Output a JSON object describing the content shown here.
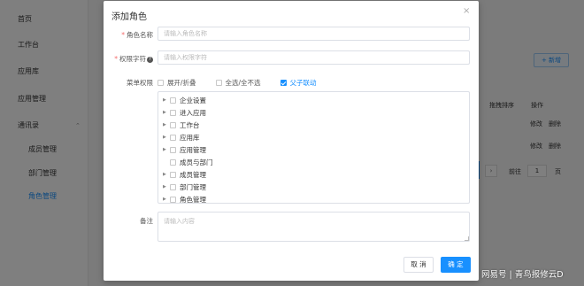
{
  "sidebar": {
    "items": [
      {
        "label": "首页"
      },
      {
        "label": "工作台"
      },
      {
        "label": "应用库"
      },
      {
        "label": "应用管理"
      },
      {
        "label": "通讯录"
      }
    ],
    "sub_items": [
      {
        "label": "成员管理"
      },
      {
        "label": "部门管理"
      },
      {
        "label": "角色管理"
      }
    ]
  },
  "background": {
    "add_button": "+ 新增",
    "table_headers": [
      "拖拽排序",
      "操作"
    ],
    "row_actions": [
      {
        "edit": "修改",
        "delete": "删除"
      },
      {
        "edit": "修改",
        "delete": "删除"
      }
    ],
    "pager": {
      "goto_label": "前往",
      "page": "1",
      "page_unit": "页"
    }
  },
  "dialog": {
    "title": "添加角色",
    "close_symbol": "×",
    "fields": {
      "role_name": {
        "label": "角色名称",
        "placeholder": "请输入角色名称",
        "value": ""
      },
      "permission_char": {
        "label": "权限字符",
        "placeholder": "请输入权限字符",
        "value": ""
      },
      "menu_permission": {
        "label": "菜单权限",
        "options": [
          {
            "label": "展开/折叠",
            "checked": false
          },
          {
            "label": "全选/全不选",
            "checked": false
          },
          {
            "label": "父子联动",
            "checked": true
          }
        ],
        "tree": [
          {
            "label": "企业设置",
            "expandable": true
          },
          {
            "label": "进入应用",
            "expandable": true
          },
          {
            "label": "工作台",
            "expandable": true
          },
          {
            "label": "应用库",
            "expandable": true
          },
          {
            "label": "应用管理",
            "expandable": true
          },
          {
            "label": "成员与部门",
            "expandable": false
          },
          {
            "label": "成员管理",
            "expandable": true
          },
          {
            "label": "部门管理",
            "expandable": true
          },
          {
            "label": "角色管理",
            "expandable": true
          }
        ]
      },
      "remark": {
        "label": "备注",
        "placeholder": "请输入内容",
        "value": ""
      }
    },
    "buttons": {
      "cancel": "取 消",
      "confirm": "确 定"
    }
  },
  "watermark": "网易号 | 青鸟报修云D",
  "colors": {
    "primary": "#1890ff",
    "required": "#f56c6c",
    "overlay": "rgba(0,0,0,0.5)"
  }
}
